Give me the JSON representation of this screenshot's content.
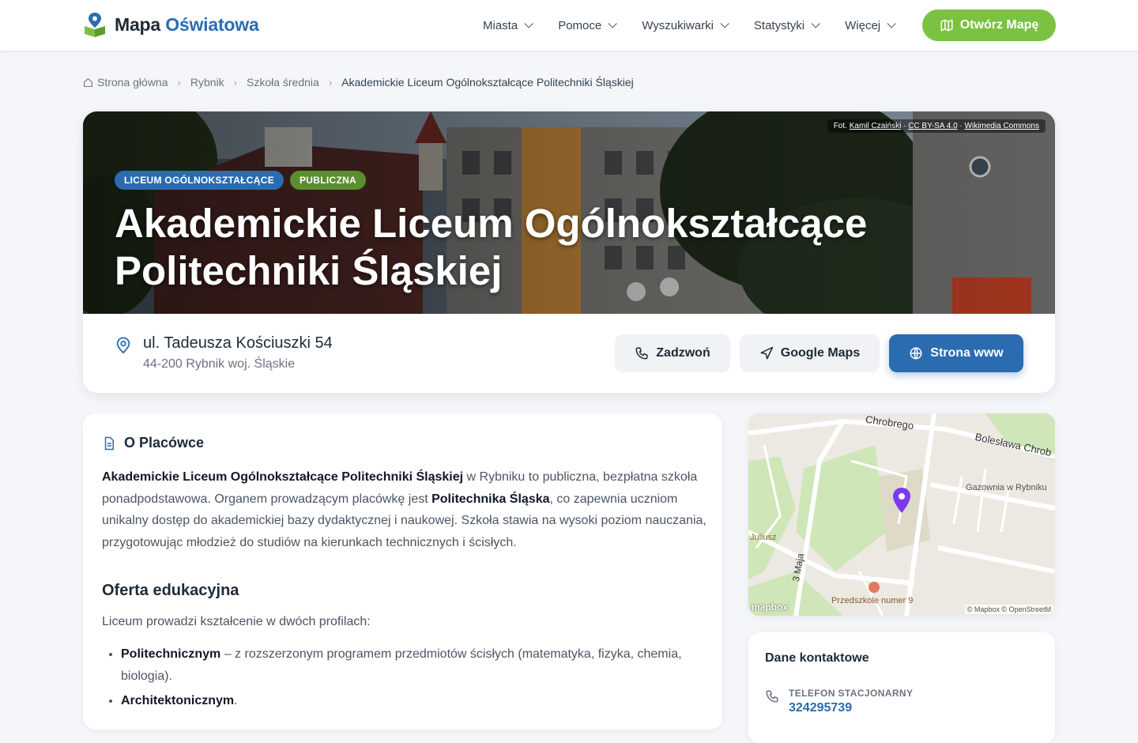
{
  "brand": {
    "name_part1": "Mapa",
    "name_part2": "Oświatowa"
  },
  "nav": {
    "items": [
      {
        "label": "Miasta"
      },
      {
        "label": "Pomoce"
      },
      {
        "label": "Wyszukiwarki"
      },
      {
        "label": "Statystyki"
      },
      {
        "label": "Więcej"
      }
    ],
    "cta_label": "Otwórz Mapę"
  },
  "breadcrumb": {
    "home": "Strona główna",
    "city": "Rybnik",
    "type": "Szkoła średnia",
    "current": "Akademickie Liceum Ogólnokształcące Politechniki Śląskiej"
  },
  "hero": {
    "photo_credit_prefix": "Fot.",
    "photo_author": "Kamil Czaiński",
    "photo_license": "CC BY-SA 4.0",
    "photo_source": "Wikimedia Commons",
    "badge_type": "LICEUM OGÓLNOKSZTAŁCĄCE",
    "badge_status": "PUBLICZNA",
    "title": "Akademickie Liceum Ogólnokształcące Politechniki Śląskiej"
  },
  "address": {
    "street": "ul. Tadeusza Kościuszki 54",
    "city_line": "44-200 Rybnik woj. Śląskie"
  },
  "actions": {
    "call": "Zadzwoń",
    "gmaps": "Google Maps",
    "www": "Strona www"
  },
  "about": {
    "heading": "O Placówce",
    "school_name": "Akademickie Liceum Ogólnokształcące Politechniki Śląskiej",
    "text_1": " w Rybniku to publiczna, bezpłatna szkoła ponadpodstawowa. Organem prowadzącym placówkę jest ",
    "organ": "Politechnika Śląska",
    "text_2": ", co zapewnia uczniom unikalny dostęp do akademickiej bazy dydaktycznej i naukowej. Szkoła stawia na wysoki poziom nauczania, przygotowując młodzież do studiów na kierunkach technicznych i ścisłych.",
    "offer_title": "Oferta edukacyjna",
    "offer_intro": "Liceum prowadzi kształcenie w dwóch profilach:",
    "profiles": [
      {
        "name": "Politechnicznym",
        "desc": " – z rozszerzonym programem przedmiotów ścisłych (matematyka, fizyka, chemia, biologia)."
      },
      {
        "name": "Architektonicznym",
        "desc": "."
      }
    ]
  },
  "map": {
    "labels": {
      "street_top": "Chrobrego",
      "street_right": "Bolesława Chrob",
      "poi_gas": "Gazownia w Rybniku",
      "street_left": "Juliusz",
      "street_3maja": "3 Maja",
      "poi_kindergarten": "Przedszkole numer 9"
    },
    "logo": "mapbox",
    "attribution": "© Mapbox © OpenStreetM"
  },
  "contact": {
    "title": "Dane kontaktowe",
    "phone_label": "TELEFON STACJONARNY",
    "phone_value": "324295739"
  },
  "colors": {
    "brand_blue": "#2b6cb0",
    "cta_green": "#7cc242",
    "badge_green": "#5a8f2f",
    "pin_purple": "#7c3aed"
  }
}
